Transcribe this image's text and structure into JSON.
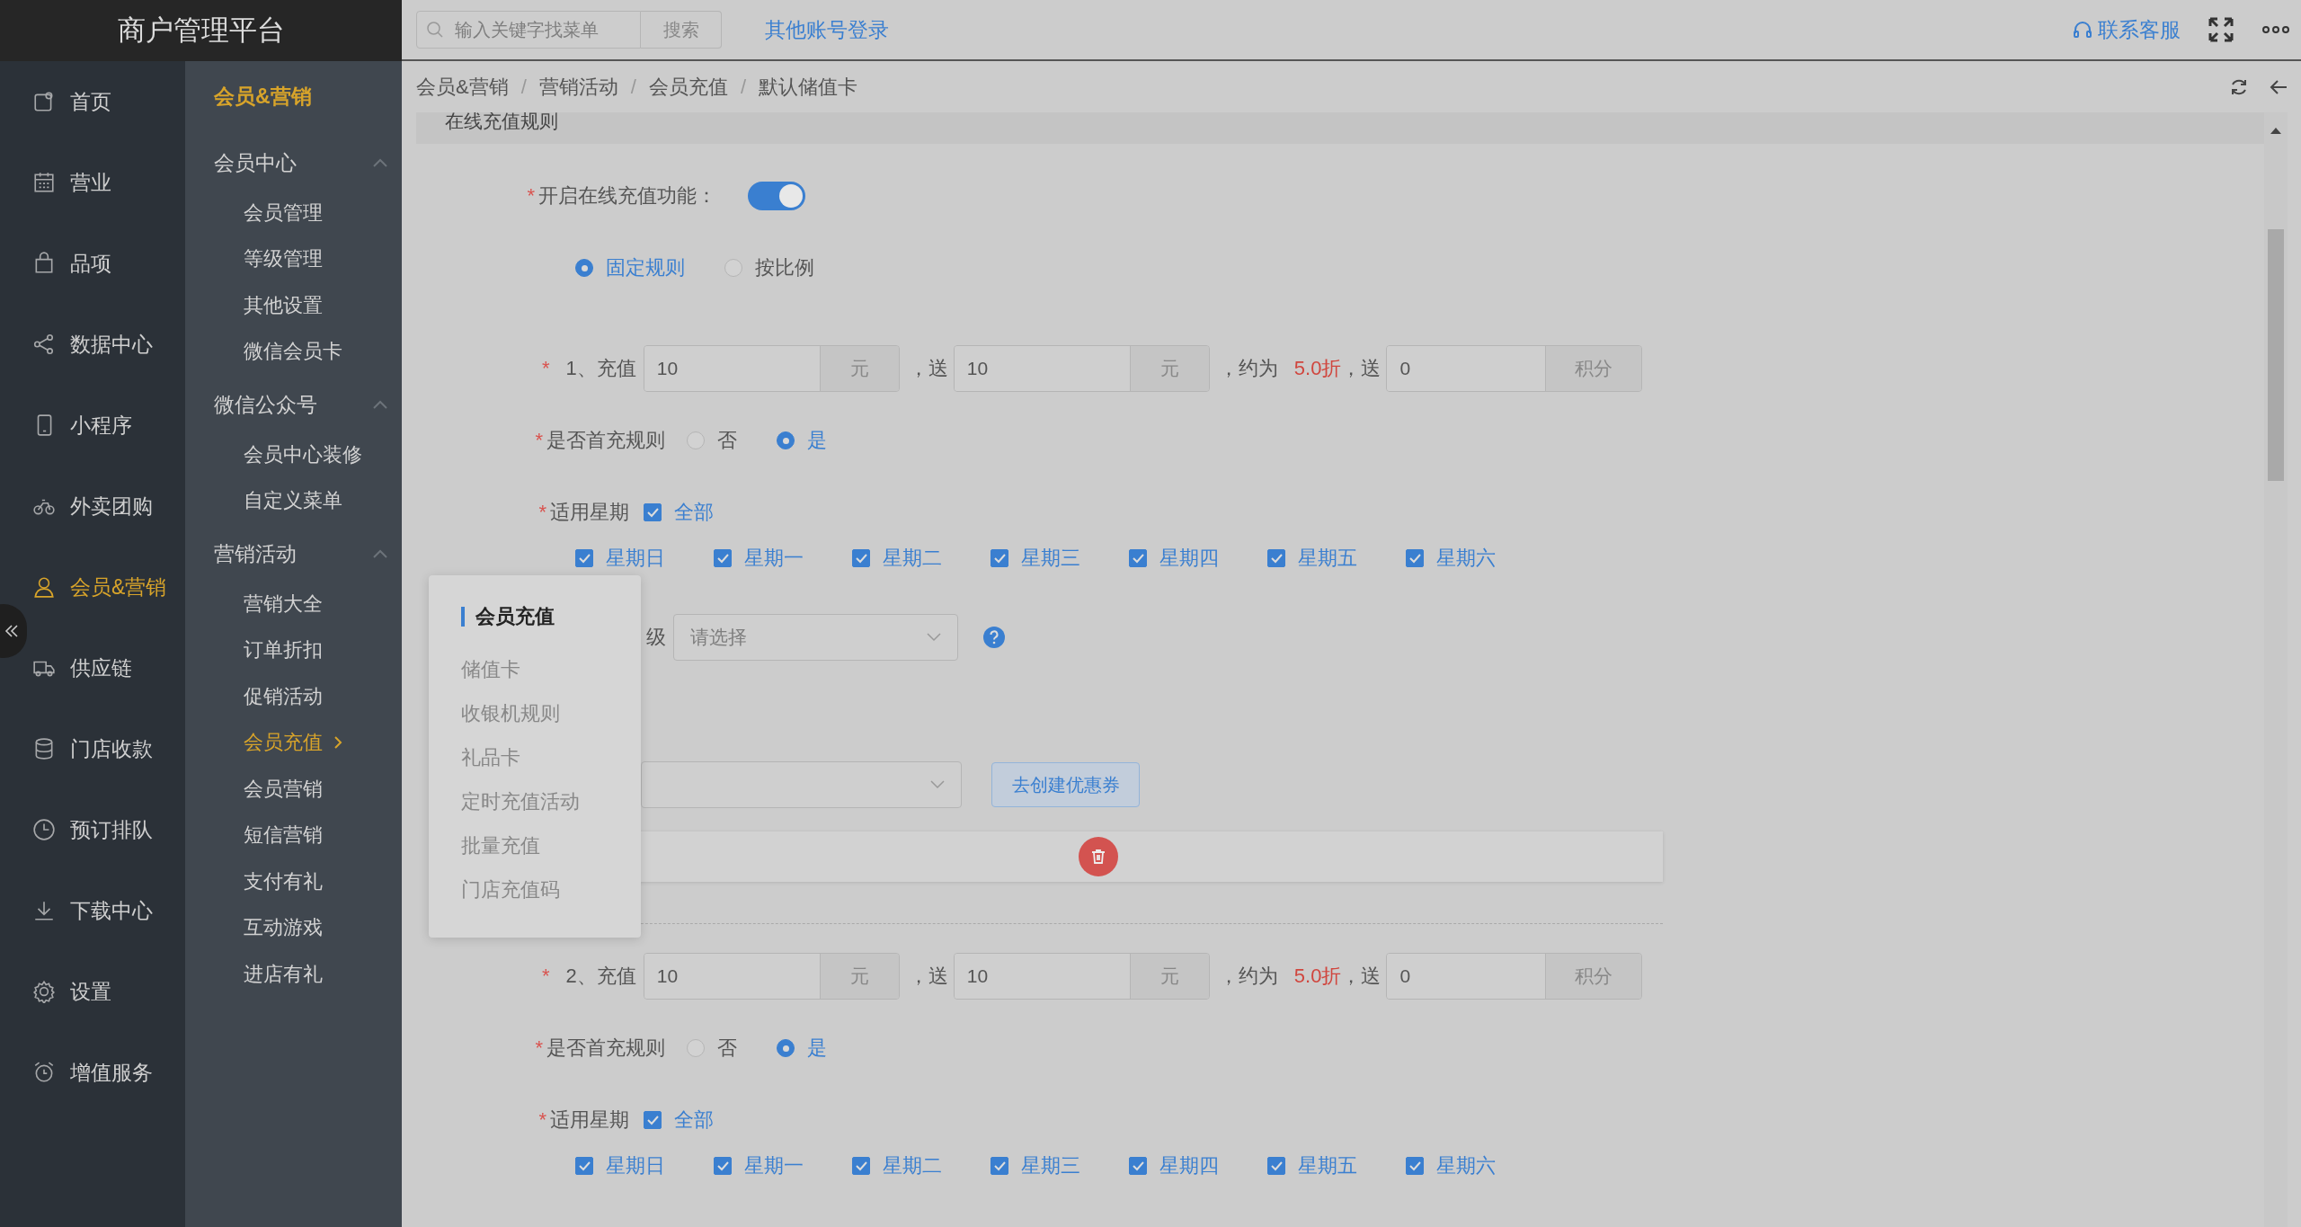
{
  "app_title": "商户管理平台",
  "search": {
    "placeholder": "输入关键字找菜单",
    "button": "搜索"
  },
  "other_login": "其他账号登录",
  "support": "联系客服",
  "nav": [
    {
      "label": "首页",
      "selected": false
    },
    {
      "label": "营业",
      "selected": false
    },
    {
      "label": "品项",
      "selected": false
    },
    {
      "label": "数据中心",
      "selected": false
    },
    {
      "label": "小程序",
      "selected": false
    },
    {
      "label": "外卖团购",
      "selected": false
    },
    {
      "label": "会员&营销",
      "selected": true
    },
    {
      "label": "供应链",
      "selected": false
    },
    {
      "label": "门店收款",
      "selected": false
    },
    {
      "label": "预订排队",
      "selected": false
    },
    {
      "label": "下载中心",
      "selected": false
    },
    {
      "label": "设置",
      "selected": false
    },
    {
      "label": "增值服务",
      "selected": false
    }
  ],
  "subnav": {
    "title": "会员&营销",
    "groups": [
      {
        "label": "会员中心",
        "expanded": true,
        "items": [
          {
            "label": "会员管理",
            "selected": false
          },
          {
            "label": "等级管理",
            "selected": false
          },
          {
            "label": "其他设置",
            "selected": false
          },
          {
            "label": "微信会员卡",
            "selected": false
          }
        ]
      },
      {
        "label": "微信公众号",
        "expanded": true,
        "items": [
          {
            "label": "会员中心装修",
            "selected": false
          },
          {
            "label": "自定义菜单",
            "selected": false
          }
        ]
      },
      {
        "label": "营销活动",
        "expanded": true,
        "items": [
          {
            "label": "营销大全",
            "selected": false
          },
          {
            "label": "订单折扣",
            "selected": false
          },
          {
            "label": "促销活动",
            "selected": false
          },
          {
            "label": "会员充值",
            "selected": true
          },
          {
            "label": "会员营销",
            "selected": false
          },
          {
            "label": "短信营销",
            "selected": false
          },
          {
            "label": "支付有礼",
            "selected": false
          },
          {
            "label": "互动游戏",
            "selected": false
          },
          {
            "label": "进店有礼",
            "selected": false
          }
        ]
      }
    ]
  },
  "breadcrumb": {
    "separator": "/",
    "items": [
      "会员&营销",
      "营销活动",
      "会员充值",
      "默认储值卡"
    ]
  },
  "section_title": "在线充值规则",
  "online_recharge": {
    "required_mark": "*",
    "label": "开启在线充值功能：",
    "on": true
  },
  "mode_options": [
    {
      "label": "固定规则",
      "selected": true
    },
    {
      "label": "按比例",
      "selected": false
    }
  ],
  "rules": [
    {
      "required_mark": "*",
      "index_label": "1、充值",
      "amount": "10",
      "unit": "元",
      "gift_label": "，送",
      "gift": "10",
      "gift_unit": "元",
      "approx_label": "，约为",
      "discount": "5.0折",
      "points_label": "，送",
      "points": "0",
      "points_unit": "积分",
      "first": {
        "required_mark": "*",
        "label": "是否首充规则",
        "options": [
          {
            "label": "否",
            "selected": false
          },
          {
            "label": "是",
            "selected": true
          }
        ]
      },
      "weekday": {
        "required_mark": "*",
        "label": "适用星期",
        "all": {
          "label": "全部",
          "checked": true
        },
        "days": [
          {
            "label": "星期日",
            "checked": true
          },
          {
            "label": "星期一",
            "checked": true
          },
          {
            "label": "星期二",
            "checked": true
          },
          {
            "label": "星期三",
            "checked": true
          },
          {
            "label": "星期四",
            "checked": true
          },
          {
            "label": "星期五",
            "checked": true
          },
          {
            "label": "星期六",
            "checked": true
          }
        ]
      },
      "level": {
        "label": "级",
        "placeholder": "请选择"
      },
      "coupon": {
        "button": "去创建优惠券"
      }
    },
    {
      "required_mark": "*",
      "index_label": "2、充值",
      "amount": "10",
      "unit": "元",
      "gift_label": "，送",
      "gift": "10",
      "gift_unit": "元",
      "approx_label": "，约为",
      "discount": "5.0折",
      "points_label": "，送",
      "points": "0",
      "points_unit": "积分",
      "first": {
        "required_mark": "*",
        "label": "是否首充规则",
        "options": [
          {
            "label": "否",
            "selected": false
          },
          {
            "label": "是",
            "selected": true
          }
        ]
      },
      "weekday": {
        "required_mark": "*",
        "label": "适用星期",
        "all": {
          "label": "全部",
          "checked": true
        },
        "days": [
          {
            "label": "星期日",
            "checked": true
          },
          {
            "label": "星期一",
            "checked": true
          },
          {
            "label": "星期二",
            "checked": true
          },
          {
            "label": "星期三",
            "checked": true
          },
          {
            "label": "星期四",
            "checked": true
          },
          {
            "label": "星期五",
            "checked": true
          },
          {
            "label": "星期六",
            "checked": true
          }
        ]
      }
    }
  ],
  "popup_menu": {
    "title": "会员充值",
    "items": [
      "储值卡",
      "收银机规则",
      "礼品卡",
      "定时充值活动",
      "批量充值",
      "门店充值码"
    ]
  }
}
